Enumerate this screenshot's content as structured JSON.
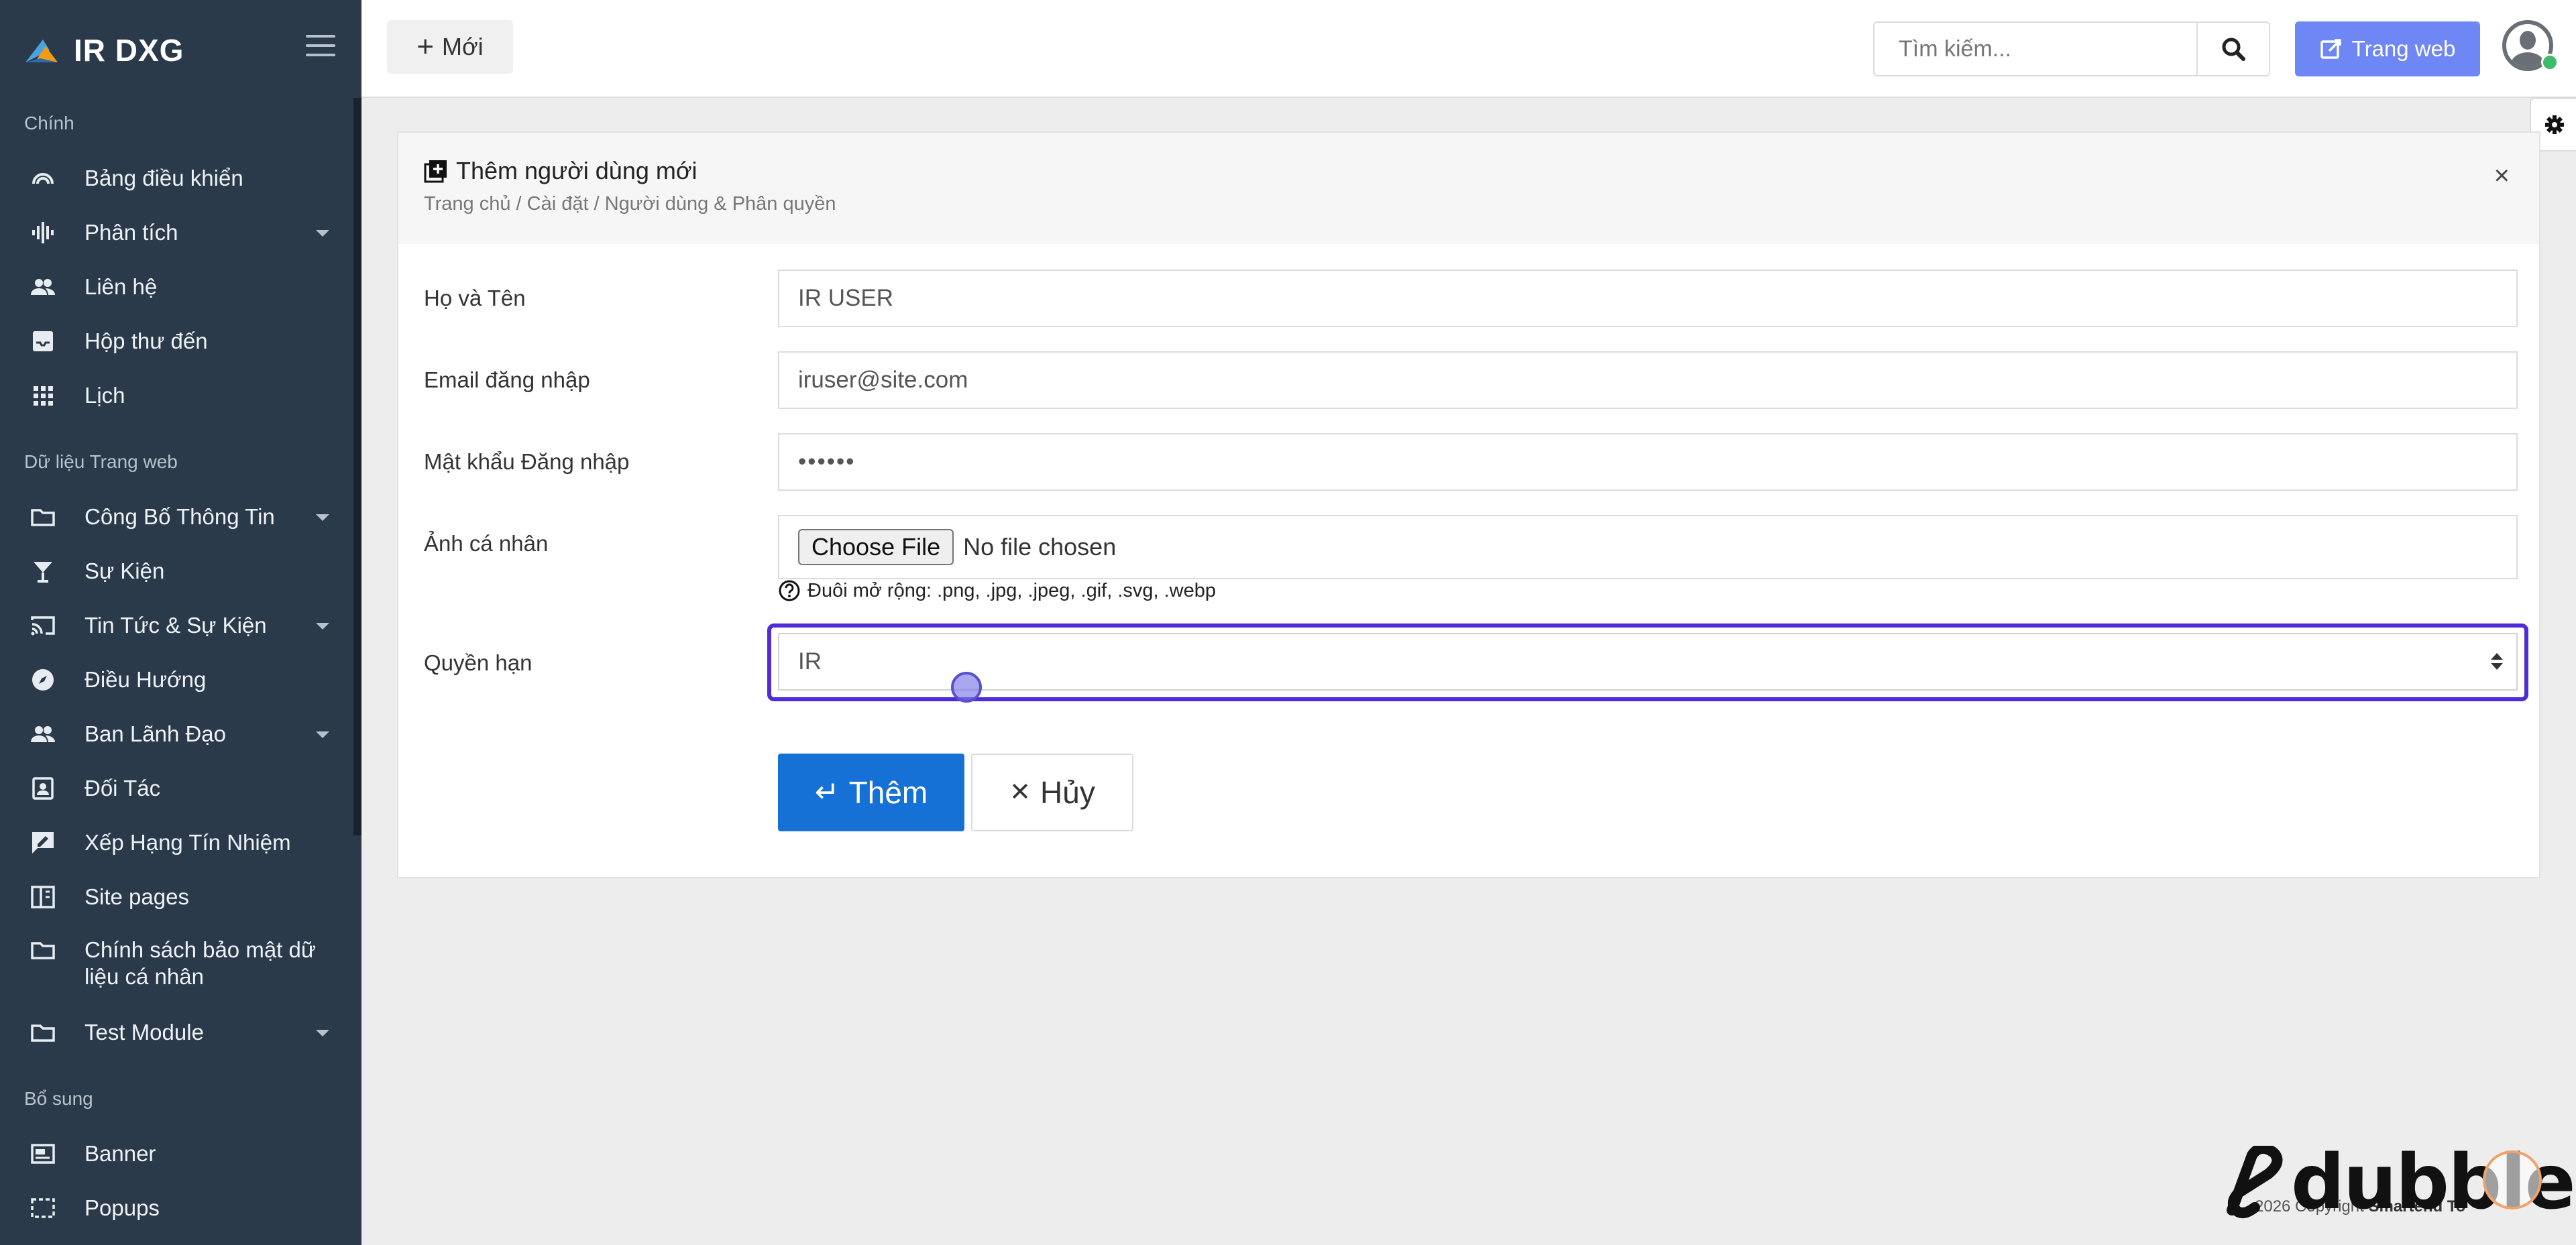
{
  "brand": {
    "name": "IR DXG"
  },
  "sidebar": {
    "sections": [
      {
        "label": "Chính"
      },
      {
        "label": "Dữ liệu Trang web"
      },
      {
        "label": "Bổ sung"
      }
    ],
    "items": [
      {
        "label": "Bảng điều khiển",
        "icon": "dashboard-gauge-icon"
      },
      {
        "label": "Phân tích",
        "icon": "audio-wave-icon",
        "has_submenu": true
      },
      {
        "label": "Liên hệ",
        "icon": "people-icon"
      },
      {
        "label": "Hộp thư đến",
        "icon": "inbox-icon"
      },
      {
        "label": "Lịch",
        "icon": "grid-apps-icon"
      },
      {
        "label": "Công Bố Thông Tin",
        "icon": "folder-icon",
        "has_submenu": true
      },
      {
        "label": "Sự Kiện",
        "icon": "cocktail-glass-icon"
      },
      {
        "label": "Tin Tức & Sự Kiện",
        "icon": "cast-icon",
        "has_submenu": true
      },
      {
        "label": "Điều Hướng",
        "icon": "compass-icon"
      },
      {
        "label": "Ban Lãnh Đạo",
        "icon": "people-icon",
        "has_submenu": true
      },
      {
        "label": "Đối Tác",
        "icon": "contact-card-icon"
      },
      {
        "label": "Xếp Hạng Tín Nhiệm",
        "icon": "rate-review-icon"
      },
      {
        "label": "Site pages",
        "icon": "book-pages-icon"
      },
      {
        "label": "Chính sách bảo mật dữ liệu cá nhân",
        "icon": "folder-icon"
      },
      {
        "label": "Test Module",
        "icon": "folder-icon",
        "has_submenu": true
      },
      {
        "label": "Banner",
        "icon": "banner-icon"
      },
      {
        "label": "Popups",
        "icon": "popup-icon"
      }
    ]
  },
  "topbar": {
    "new_label": "Mới",
    "search_placeholder": "Tìm kiếm...",
    "website_label": "Trang web"
  },
  "card": {
    "title": "Thêm người dùng mới",
    "breadcrumb": "Trang chủ / Cài đặt / Người dùng & Phân quyền"
  },
  "form": {
    "name_label": "Họ và Tên",
    "name_value": "IR USER",
    "email_label": "Email đăng nhập",
    "email_value": "iruser@site.com",
    "password_label": "Mật khẩu Đăng nhập",
    "password_value": "••••••",
    "avatar_label": "Ảnh cá nhân",
    "choose_file_label": "Choose File",
    "no_file_text": "No file chosen",
    "extensions_hint": "Đuôi mở rộng: .png, .jpg, .jpeg, .gif, .svg, .webp",
    "role_label": "Quyền hạn",
    "role_value": "IR",
    "submit_label": "Thêm",
    "cancel_label": "Hủy"
  },
  "footer": {
    "copyright_prefix": "2026 Copyright ",
    "copyright_brand": "Smartend To"
  },
  "watermark": {
    "text": "dubble"
  },
  "colors": {
    "sidebar_bg": "#2b3a4b",
    "accent_blue": "#1671d6",
    "website_button": "#6f86f5",
    "focus_ring": "#4f2bd9"
  }
}
